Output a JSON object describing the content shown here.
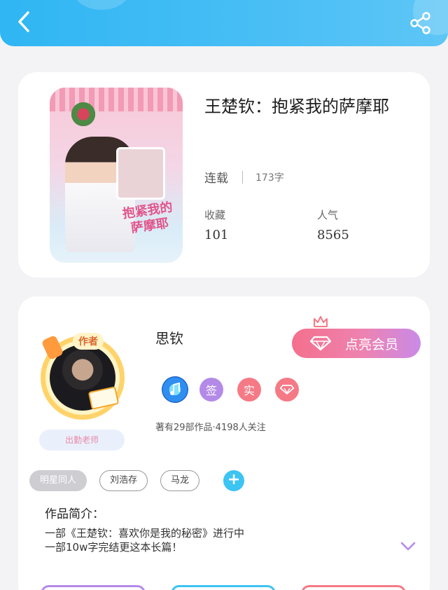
{
  "header": {
    "back_icon": "chevron-left-icon",
    "share_icon": "share-icon"
  },
  "book": {
    "title": "王楚钦：抱紧我的萨摩耶",
    "cover_title_art": "抱紧我的萨摩耶",
    "status": "连载",
    "word_count": "173字",
    "favorites_label": "收藏",
    "favorites_value": "101",
    "popularity_label": "人气",
    "popularity_value": "8565"
  },
  "author": {
    "name": "思钦",
    "badge": "作者",
    "label": "出勤老师",
    "vip_button": "点亮会员",
    "badges": [
      "签",
      "实"
    ],
    "works_info": "著有29部作品·4198人关注"
  },
  "tags": [
    "明星同人",
    "刘浩存",
    "马龙"
  ],
  "intro": {
    "title": "作品简介：",
    "line1": "一部《王楚钦：喜欢你是我的秘密》进行中",
    "line2": "一部10w字完结更这本长篇！"
  },
  "colors": {
    "header_blue": "#2fb6f3",
    "vip_gradient_start": "#f4708c",
    "vip_gradient_end": "#c98ae8",
    "add_tag": "#3cc4f2"
  }
}
